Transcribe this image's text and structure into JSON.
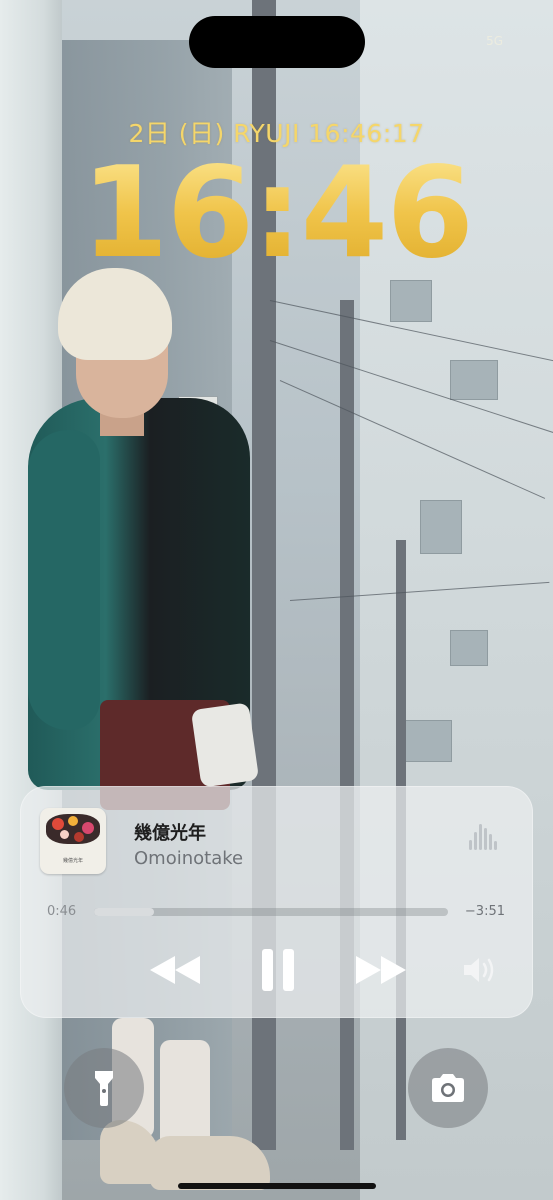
{
  "status": {
    "carrier_mark": "5G"
  },
  "lock": {
    "date_line": "2日 (日)  RYUJI 16:46:17",
    "time": "16:46"
  },
  "now_playing": {
    "title": "幾億光年",
    "artist": "Omoinotake",
    "elapsed": "0:46",
    "remaining": "−3:51",
    "progress_fraction": 0.17,
    "art_caption": "幾億光年"
  },
  "icons": {
    "rewind": "rewind-icon",
    "pause": "pause-icon",
    "fast_forward": "fast-forward-icon",
    "volume": "speaker-icon",
    "waveform": "waveform-icon",
    "flashlight": "flashlight-icon",
    "camera": "camera-icon"
  },
  "colors": {
    "clock_gold": "#f1cb52",
    "widget_bg": "#eceef0",
    "control_white": "#ffffff"
  }
}
